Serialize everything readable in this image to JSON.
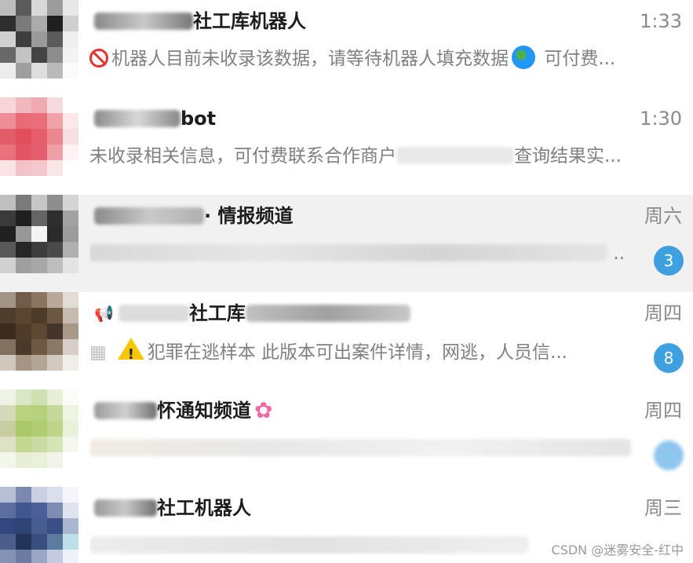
{
  "chats": [
    {
      "name": "社工库机器人",
      "time": "1:33",
      "preview": "机器人目前未收录该数据，请等待机器人填充数据",
      "preview_tail": "可付费...",
      "badge": ""
    },
    {
      "name": "bot",
      "time": "1:30",
      "preview": "未收录相关信息，可付费联系合作商户",
      "preview_tail": "查询结果实...",
      "badge": ""
    },
    {
      "name": "· 情报频道",
      "time": "周六",
      "preview": "",
      "preview_tail": "..",
      "badge": "3"
    },
    {
      "name": "社工库",
      "time": "周四",
      "preview": "犯罪在逃样本  此版本可出案件详情，网逃，人员信...",
      "preview_tail": "",
      "badge": "8"
    },
    {
      "name": "怀通知频道",
      "time": "周四",
      "preview": "",
      "preview_tail": "",
      "badge": ""
    },
    {
      "name": "社工机器人",
      "time": "周三",
      "preview": "",
      "preview_tail": "",
      "badge": ""
    }
  ],
  "icons": [
    "prohibited-icon",
    "globe-icon",
    "megaphone-icon",
    "warning-icon",
    "flower-icon"
  ],
  "accent_color": "#3fa0e0",
  "watermark": "CSDN @迷雾安全-红中"
}
